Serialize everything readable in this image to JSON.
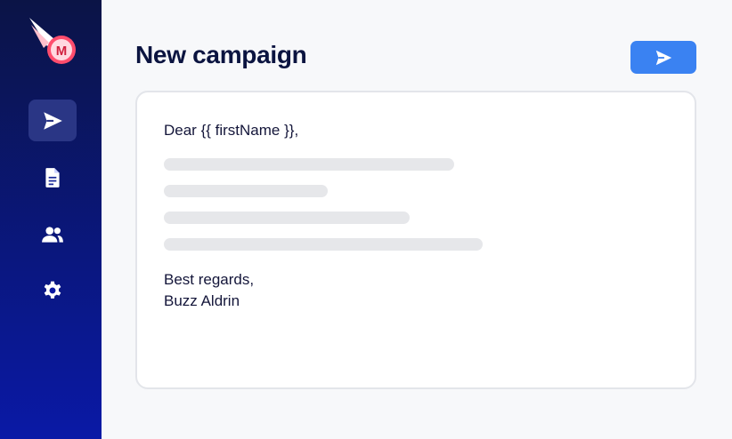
{
  "app": {
    "logo_icon": "meteor-m-logo",
    "accent_color": "#3a82f2"
  },
  "sidebar": {
    "items": [
      {
        "icon": "send-icon",
        "active": true
      },
      {
        "icon": "document-icon",
        "active": false
      },
      {
        "icon": "users-icon",
        "active": false
      },
      {
        "icon": "gear-icon",
        "active": false
      }
    ]
  },
  "header": {
    "title": "New campaign",
    "send_icon": "send-icon"
  },
  "email": {
    "greeting": "Dear {{ firstName }},",
    "closing_line1": "Best regards,",
    "closing_line2": "Buzz Aldrin"
  }
}
